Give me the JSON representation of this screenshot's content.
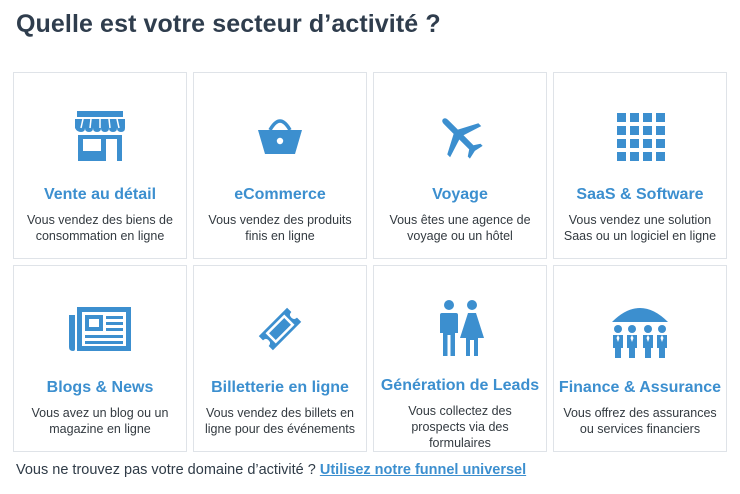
{
  "header": {
    "title": "Quelle est votre secteur d’activité ?"
  },
  "accent_color": "#3c8fcf",
  "sectors": [
    {
      "icon": "storefront-icon",
      "name": "Vente au détail",
      "description": "Vous vendez des biens de consommation en ligne"
    },
    {
      "icon": "shopping-basket-icon",
      "name": "eCommerce",
      "description": "Vous vendez des produits finis en ligne"
    },
    {
      "icon": "airplane-icon",
      "name": "Voyage",
      "description": "Vous êtes une agence de voyage ou un hôtel"
    },
    {
      "icon": "grid-apps-icon",
      "name": "SaaS & Software",
      "description": "Vous vendez une solution Saas ou un logiciel en ligne"
    },
    {
      "icon": "newspaper-icon",
      "name": "Blogs & News",
      "description": "Vous avez un blog ou un magazine en ligne"
    },
    {
      "icon": "ticket-icon",
      "name": "Billetterie en ligne",
      "description": "Vous vendez des billets en ligne pour des événements"
    },
    {
      "icon": "people-icon",
      "name": "Génération de Leads",
      "description": "Vous collectez des prospects via des formulaires"
    },
    {
      "icon": "umbrella-group-icon",
      "name": "Finance & Assurance",
      "description": "Vous offrez des assurances ou services financiers"
    }
  ],
  "footer": {
    "text": "Vous ne trouvez pas votre domaine d’activité ?",
    "link_label": "Utilisez notre funnel universel"
  }
}
